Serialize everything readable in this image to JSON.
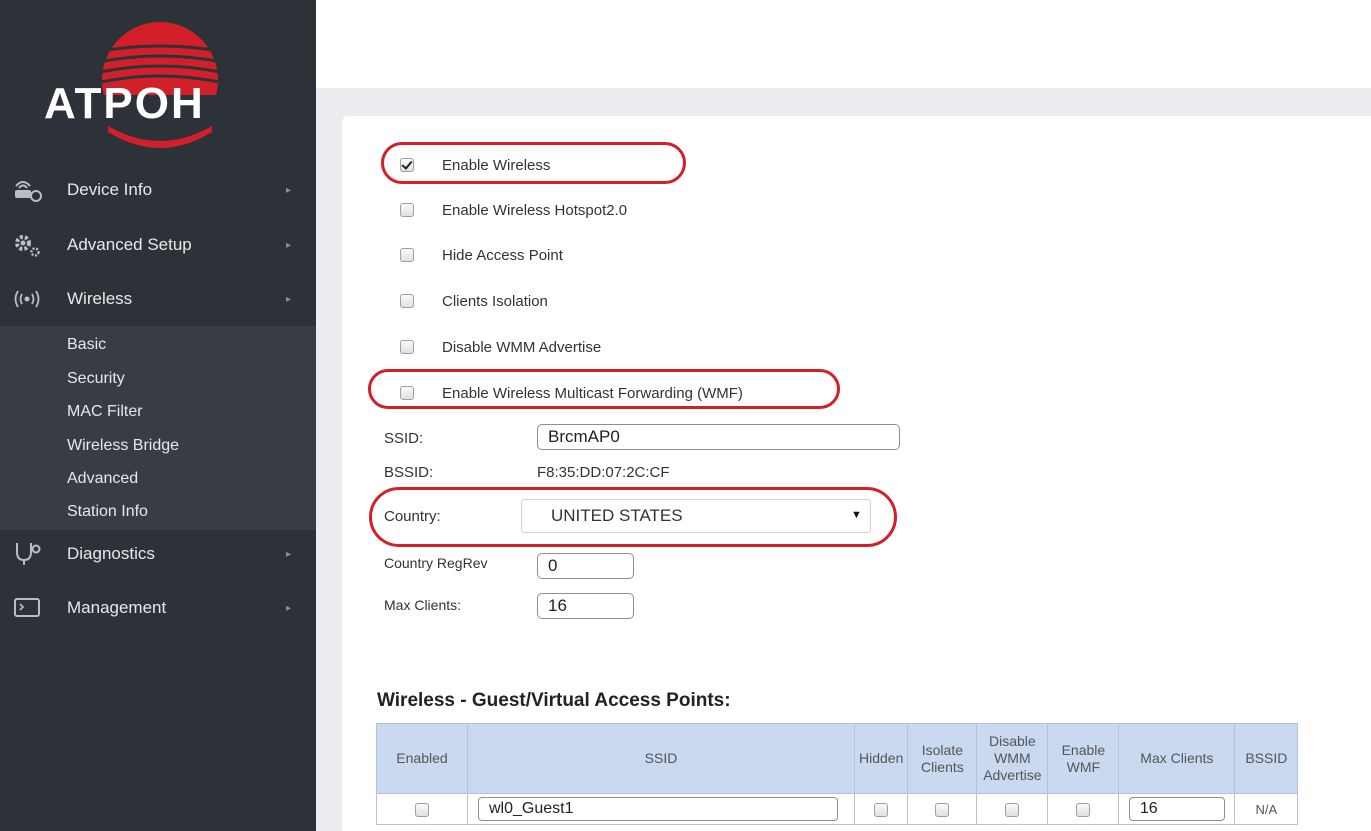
{
  "brand": {
    "logo_text": "ATPOH",
    "accent": "#d21f2a"
  },
  "sidebar": {
    "items": [
      {
        "label": "Device Info",
        "icon": "router-icon"
      },
      {
        "label": "Advanced Setup",
        "icon": "gears-icon"
      },
      {
        "label": "Wireless",
        "icon": "wireless-signal-icon"
      },
      {
        "label": "Diagnostics",
        "icon": "stethoscope-icon"
      },
      {
        "label": "Management",
        "icon": "monitor-icon"
      }
    ],
    "wireless_sub": [
      "Basic",
      "Security",
      "MAC Filter",
      "Wireless Bridge",
      "Advanced",
      "Station Info"
    ]
  },
  "options": [
    {
      "label": "Enable Wireless",
      "checked": true
    },
    {
      "label": "Enable Wireless Hotspot2.0",
      "checked": false
    },
    {
      "label": "Hide Access Point",
      "checked": false
    },
    {
      "label": "Clients Isolation",
      "checked": false
    },
    {
      "label": "Disable WMM Advertise",
      "checked": false
    },
    {
      "label": "Enable Wireless Multicast Forwarding (WMF)",
      "checked": false
    }
  ],
  "fields": {
    "ssid_label": "SSID:",
    "ssid_value": "BrcmAP0",
    "bssid_label": "BSSID:",
    "bssid_value": "F8:35:DD:07:2C:CF",
    "country_label": "Country:",
    "country_value": "UNITED STATES",
    "regrev_label": "Country RegRev",
    "regrev_value": "0",
    "max_clients_label": "Max Clients:",
    "max_clients_value": "16"
  },
  "guest_section": {
    "title": "Wireless - Guest/Virtual Access Points:",
    "headers": [
      "Enabled",
      "SSID",
      "Hidden",
      "Isolate Clients",
      "Disable WMM Advertise",
      "Enable WMF",
      "Max Clients",
      "BSSID"
    ],
    "rows": [
      {
        "ssid": "wl0_Guest1",
        "max_clients": "16",
        "bssid": "N/A"
      }
    ]
  }
}
